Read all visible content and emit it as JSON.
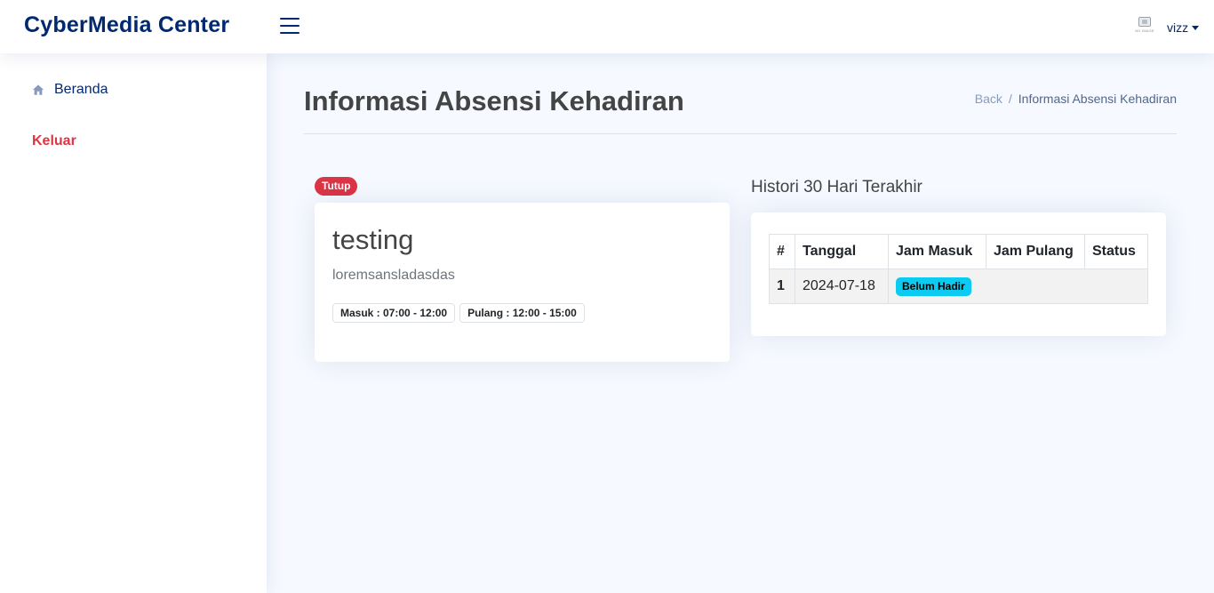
{
  "header": {
    "brand": "CyberMedia Center",
    "avatar_caption": "NO IMAGE",
    "username": "vizz"
  },
  "sidebar": {
    "items": [
      {
        "label": "Beranda",
        "icon": "home-icon"
      },
      {
        "label": "Keluar",
        "color": "#dc3545"
      }
    ]
  },
  "page": {
    "title": "Informasi Absensi Kehadiran",
    "breadcrumb": {
      "back": "Back",
      "separator": "/",
      "current": "Informasi Absensi Kehadiran"
    }
  },
  "attendance_card": {
    "status_badge": "Tutup",
    "title": "testing",
    "description": "loremsansladasdas",
    "masuk": "Masuk : 07:00 - 12:00",
    "pulang": "Pulang : 12:00 - 15:00"
  },
  "history": {
    "title": "Histori 30 Hari Terakhir",
    "columns": [
      "#",
      "Tanggal",
      "Jam Masuk",
      "Jam Pulang",
      "Status"
    ],
    "rows": [
      {
        "no": "1",
        "tanggal": "2024-07-18",
        "status_badge": "Belum Hadir"
      }
    ]
  },
  "colors": {
    "brand": "#012970",
    "danger": "#dc3545",
    "info": "#0dcaf0",
    "background": "#f6f9ff"
  }
}
